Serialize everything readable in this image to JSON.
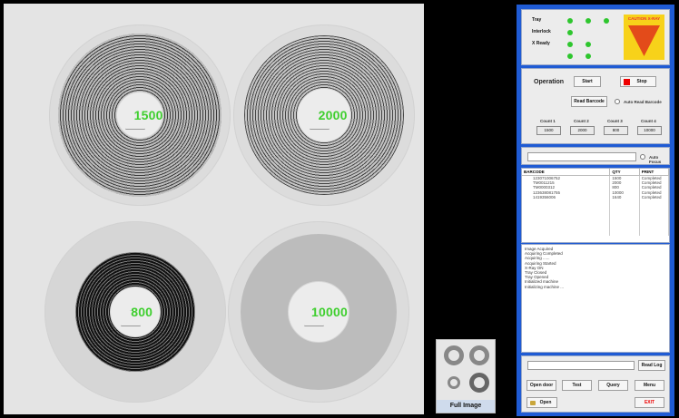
{
  "viewer": {
    "reels": [
      {
        "count": "1500"
      },
      {
        "count": "2000"
      },
      {
        "count": "800"
      },
      {
        "count": "10000"
      }
    ]
  },
  "thumbnail": {
    "label": "Full Image"
  },
  "status": {
    "labels": [
      "Tray",
      "Interlock",
      "X Ready"
    ],
    "warning_text": "CAUTION X-RAY",
    "led_color": "#2ec62e"
  },
  "operation": {
    "title": "Operation",
    "start": "Start",
    "stop": "Stop",
    "read_barcode": "Read Barcode",
    "auto_read_barcode": "Auto Read Barcode",
    "counts": [
      {
        "label": "Count 1",
        "value": "1500"
      },
      {
        "label": "Count 2",
        "value": "2000"
      },
      {
        "label": "Count 3",
        "value": "800"
      },
      {
        "label": "Count 4",
        "value": "10000"
      }
    ]
  },
  "focus": {
    "auto_focus": "Auto Focus"
  },
  "table": {
    "headers": [
      "BARCODE",
      "QTY",
      "PRINT"
    ],
    "rows": [
      [
        "123071006752",
        "1500",
        "Completed"
      ],
      [
        "TM0011215",
        "2000",
        "Completed"
      ],
      [
        "TM0000312",
        "800",
        "Completed"
      ],
      [
        "123638081755",
        "10000",
        "Completed"
      ],
      [
        "1419356006",
        "1640",
        "Completed"
      ]
    ]
  },
  "log": [
    "Image Acquired",
    "Acquiring Completed",
    "Acquiring ......",
    "Acquiring Started",
    "X-Ray ON",
    "Tray Closed",
    "Tray Opened",
    "Initialized machine",
    "Initializing machine ..."
  ],
  "bottom": {
    "read_log": "Read Log",
    "open_door": "Open door",
    "test": "Test",
    "query": "Query",
    "menu": "Menu",
    "open": "Open",
    "exit": "EXIT"
  },
  "colors": {
    "panel": "#1f5bd4",
    "count_text": "#3fcf2f",
    "stop_red": "#e00000"
  }
}
